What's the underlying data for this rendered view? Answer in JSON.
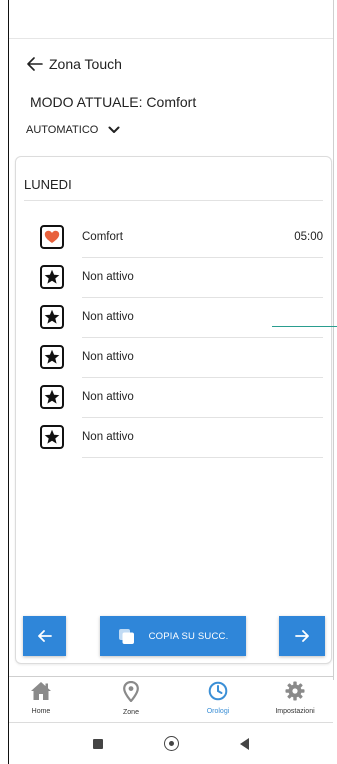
{
  "header": {
    "back_label": "Zona Touch",
    "mode_label": "MODO ATTUALE: Comfort",
    "mode_select_value": "AUTOMATICO"
  },
  "schedule": {
    "day": "LUNEDI",
    "rows": [
      {
        "icon": "heart-icon",
        "label": "Comfort",
        "time": "05:00"
      },
      {
        "icon": "star-icon",
        "label": "Non attivo",
        "time": ""
      },
      {
        "icon": "star-icon",
        "label": "Non attivo",
        "time": ""
      },
      {
        "icon": "star-icon",
        "label": "Non attivo",
        "time": ""
      },
      {
        "icon": "star-icon",
        "label": "Non attivo",
        "time": ""
      },
      {
        "icon": "star-icon",
        "label": "Non attivo",
        "time": ""
      }
    ]
  },
  "actions": {
    "copy_label": "COPIA SU SUCC.",
    "prev_icon": "arrow-left-icon",
    "next_icon": "arrow-right-icon"
  },
  "bottom_nav": {
    "items": [
      {
        "label": "Home",
        "icon": "home-icon",
        "active": false
      },
      {
        "label": "Zone",
        "icon": "location-pin-icon",
        "active": false
      },
      {
        "label": "Orologi",
        "icon": "clock-icon",
        "active": true
      },
      {
        "label": "Impostazioni",
        "icon": "gear-icon",
        "active": false
      }
    ]
  },
  "colors": {
    "accent": "#2f86d9",
    "heart": "#e8613c",
    "active_nav": "#3b8fd6",
    "teal_line": "#2a9d8f"
  }
}
